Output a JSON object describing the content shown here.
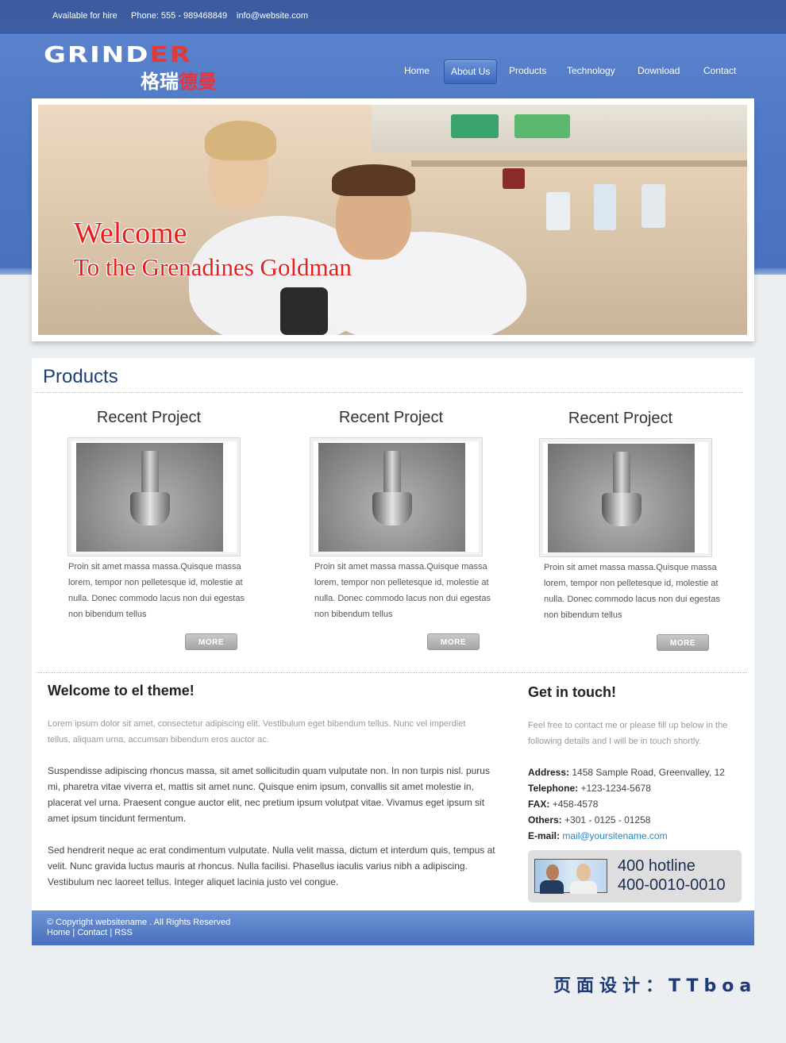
{
  "topbar": {
    "availability": "Available for hire",
    "phone": "Phone: 555 - 989468849",
    "email": "info@website.com"
  },
  "logo": {
    "en_white": "GRIND",
    "en_red": "ER",
    "cn_white": "格瑞",
    "cn_red": "德曼"
  },
  "nav": {
    "items": [
      {
        "label": "Home"
      },
      {
        "label": "About Us",
        "active": true
      },
      {
        "label": "Products"
      },
      {
        "label": "Technology"
      },
      {
        "label": "Download"
      },
      {
        "label": "Contact"
      }
    ]
  },
  "hero": {
    "line1": "Welcome",
    "line2": "To the Grenadines Goldman"
  },
  "products": {
    "title": "Products",
    "cards": [
      {
        "title": "Recent Project",
        "text": "Proin sit amet massa massa.Quisque massa lorem, tempor non pelletesque id, molestie at nulla. Donec commodo lacus non dui egestas non bibendum tellus",
        "more": "MORE"
      },
      {
        "title": "Recent Project",
        "text": "Proin sit amet massa massa.Quisque massa lorem, tempor non pelletesque id, molestie at nulla. Donec commodo lacus non dui egestas non bibendum tellus",
        "more": "MORE"
      },
      {
        "title": "Recent Project",
        "text": "Proin sit amet massa massa.Quisque massa lorem, tempor non pelletesque id, molestie at nulla. Donec commodo lacus non dui egestas non bibendum tellus",
        "more": "MORE"
      }
    ]
  },
  "welcome_section": {
    "title": "Welcome to el theme!",
    "intro": "Lorem ipsum dolor sit amet, consectetur adipiscing elit. Vestibulum eget bibendum tellus. Nunc vel imperdiet tellus, aliquam urna, accumsan bibendum eros auctor ac.",
    "para1": "Suspendisse adipiscing rhoncus massa, sit amet sollicitudin quam vulputate non. In non turpis nisl. purus mi, pharetra vitae viverra et, mattis sit amet nunc. Quisque enim ipsum, convallis sit amet molestie in, placerat vel urna. Praesent congue auctor elit, nec pretium ipsum volutpat vitae. Vivamus eget ipsum sit amet ipsum tincidunt fermentum.",
    "para2": "Sed hendrerit neque ac erat condimentum vulputate. Nulla velit massa, dictum et interdum quis, tempus at velit. Nunc gravida luctus mauris at rhoncus. Nulla facilisi. Phasellus iaculis varius nibh a adipiscing. Vestibulum nec laoreet tellus. Integer aliquet lacinia justo vel congue."
  },
  "contact": {
    "title": "Get in touch!",
    "intro": "Feel free to contact me or please fill up below in the following details and I will be in touch shortly.",
    "address_label": "Address:",
    "address": "1458 Sample Road, Greenvalley, 12",
    "telephone_label": "Telephone:",
    "telephone": "+123-1234-5678",
    "fax_label": "FAX:",
    "fax": "+458-4578",
    "others_label": "Others:",
    "others": "+301 - 0125 - 01258",
    "email_label": "E-mail:",
    "email": "mail@yoursitename.com",
    "hotline_label": "400 hotline",
    "hotline_number": "400-0010-0010"
  },
  "footer": {
    "copyright": "© Copyright websitename . All Rights Reserved",
    "links": [
      "Home",
      "Contact",
      "RSS"
    ],
    "separator": "|"
  },
  "credit": "页面设计：TTboa",
  "colors": {
    "header_blue": "#4a72be",
    "title_navy": "#1d3d78",
    "welcome_red": "#e61e1e",
    "link_blue": "#1b88c8"
  }
}
